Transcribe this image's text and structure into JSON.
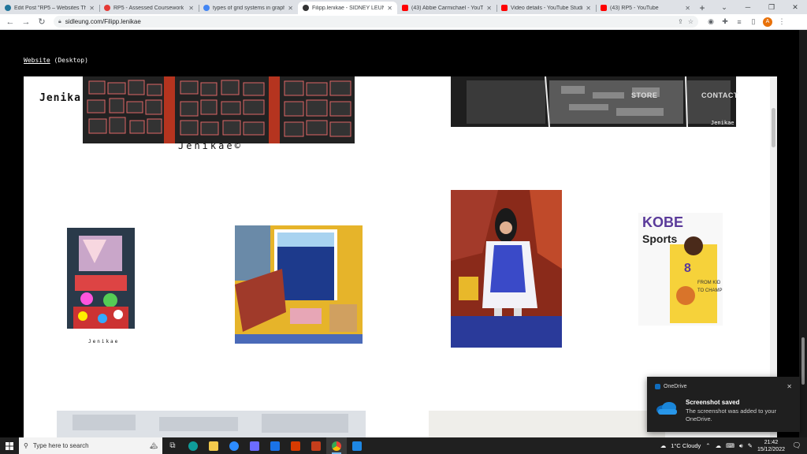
{
  "browser": {
    "tabs": [
      {
        "title": "Edit Post \"RP5 – Websites That Ir",
        "color": "#21759b",
        "active": false
      },
      {
        "title": "RP5 - Assessed Coursework - Wo",
        "color": "#e53935",
        "active": false
      },
      {
        "title": "types of grid systems in graphic",
        "color": "#4285f4",
        "active": false
      },
      {
        "title": "Filipp.lenikae - SIDNEY LEUNG",
        "color": "#333333",
        "active": true
      },
      {
        "title": "(43) Abbie Carmichael - YouTube",
        "color": "#ff0000",
        "active": false
      },
      {
        "title": "Video details - YouTube Studio",
        "color": "#ff0000",
        "active": false
      },
      {
        "title": "(43) RP5 - YouTube",
        "color": "#ff0000",
        "active": false
      }
    ],
    "new_tab": "+",
    "url": "sidleung.com/Filipp.lenikae",
    "profile_initial": "A"
  },
  "site": {
    "breadcrumb_link": "Website",
    "breadcrumb_rest": " (Desktop)",
    "logo_left": "Jenika",
    "logo_under": "Jenikae©",
    "overlay_nav": [
      "STORE",
      "CONTACT"
    ],
    "art_signature_right": "Jenikae",
    "art_signature_small": "Jenikae"
  },
  "toast": {
    "app": "OneDrive",
    "title": "Screenshot saved",
    "body": "The screenshot was added to your OneDrive."
  },
  "taskbar": {
    "search_placeholder": "Type here to search",
    "weather": "1°C  Cloudy",
    "time": "21:42",
    "date": "15/12/2022",
    "apps": [
      {
        "name": "task-view-icon",
        "color": "#dddddd"
      },
      {
        "name": "edge-icon",
        "color": "#0f9d9a"
      },
      {
        "name": "file-explorer-icon",
        "color": "#f2c94c"
      },
      {
        "name": "zoom-icon",
        "color": "#2d8cff"
      },
      {
        "name": "store-icon",
        "color": "#6c6cff"
      },
      {
        "name": "mail-icon",
        "color": "#1a73e8"
      },
      {
        "name": "office-icon",
        "color": "#d83b01"
      },
      {
        "name": "powerpoint-icon",
        "color": "#c43e1c"
      },
      {
        "name": "chrome-icon",
        "color": "#ea4335"
      },
      {
        "name": "calculator-icon",
        "color": "#1e88e5"
      }
    ]
  }
}
